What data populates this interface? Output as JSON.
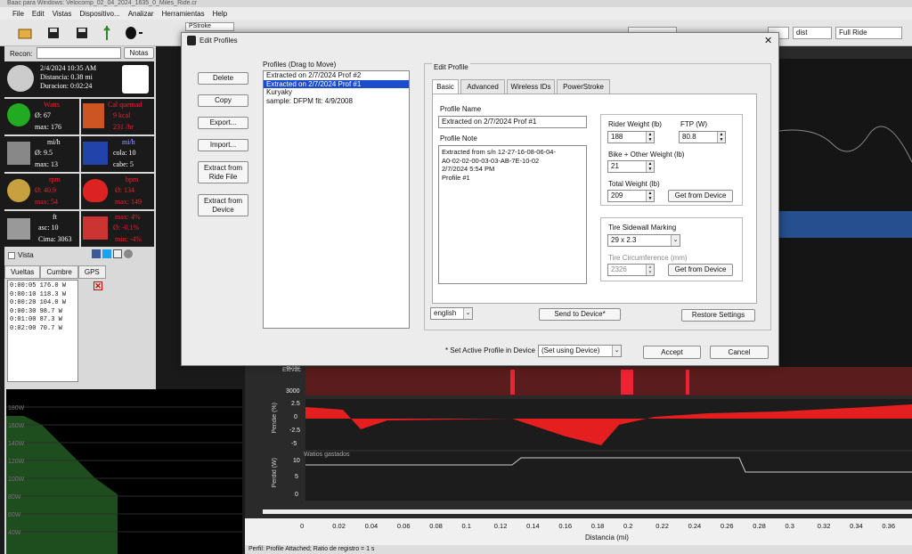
{
  "app": {
    "title": "Baac para Windows: Velocomp_02_04_2024_1635_0_Miles_Ride.cr"
  },
  "menu": [
    "File",
    "Edit",
    "Vistas",
    "Dispositivo...",
    "Analizar",
    "Herramientas",
    "Help"
  ],
  "toolbar": {
    "pstroke": "PStroke",
    "dist": "dist",
    "fullride": "Full Ride"
  },
  "left": {
    "recon": "Recon:",
    "notas": "Notas",
    "date": "2/4/2024 10:35 AM",
    "distancia": "Distancia: 0.38 mi",
    "duracion": "Duracion: 0:02:24",
    "watts": {
      "title": "Watts",
      "avg": "Ø: 67",
      "max": "max: 176"
    },
    "cal": {
      "title": "Cal quemad",
      "val": "9 kcal",
      "rate": "231 /hr"
    },
    "speed": {
      "title": "mi/h",
      "avg": "Ø: 9.5",
      "max": "max: 13"
    },
    "wind": {
      "title": "mi/h",
      "cola": "cola: 10",
      "cabe": "cabe: 5"
    },
    "rpm": {
      "title": "rpm",
      "avg": "Ø: 40.9",
      "max": "max: 54"
    },
    "bpm": {
      "title": "bpm",
      "avg": "Ø: 134",
      "max": "max: 149"
    },
    "elev": {
      "title": "ft",
      "asc": "asc: 10",
      "cima": "Cima: 3063"
    },
    "slope": {
      "max": "max: 4%",
      "avg": "Ø: -0.1%",
      "min": "min: -4%"
    },
    "vista": "Vista",
    "tabs": [
      "Vueltas",
      "Cumbre",
      "GPS"
    ],
    "laps": [
      "0:00:05 176.0 W",
      "0:00:10 118.3 W",
      "0:00:20 104.0 W",
      "0:00:30 98.7 W",
      "0:01:00 87.3 W",
      "0:02:00 70.7 W"
    ],
    "chart_y": [
      "180W",
      "160W",
      "140W",
      "120W",
      "100W",
      "80W",
      "60W",
      "40W",
      "20W",
      "0W"
    ]
  },
  "dialog": {
    "title": "Edit Profiles",
    "buttons": {
      "delete": "Delete",
      "copy": "Copy",
      "export": "Export...",
      "import": "Import...",
      "extract_ride": "Extract from Ride File",
      "extract_device": "Extract from Device"
    },
    "profiles_label": "Profiles (Drag to Move)",
    "profiles": [
      "Extracted on 2/7/2024 Prof #2",
      "Extracted on 2/7/2024 Prof #1",
      "Kuryaky",
      "sample: DFPM fit: 4/9/2008"
    ],
    "edit_profile": "Edit Profile",
    "tabs": [
      "Basic",
      "Advanced",
      "Wireless IDs",
      "PowerStroke"
    ],
    "profile_name_label": "Profile Name",
    "profile_name": "Extracted on 2/7/2024 Prof #1",
    "profile_note_label": "Profile Note",
    "profile_note": [
      "Extracted from s/n 12-27-16-08-06-04-",
      "A0-02-02-00-03-03-AB-7E-10-02",
      "2/7/2024 5:54 PM",
      "Profile #1"
    ],
    "rider_weight_label": "Rider Weight (lb)",
    "rider_weight": "188",
    "ftp_label": "FTP (W)",
    "ftp": "80.8",
    "bike_weight_label": "Bike + Other Weight (lb)",
    "bike_weight": "21",
    "total_weight_label": "Total Weight (lb)",
    "total_weight": "209",
    "get_from_device": "Get from Device",
    "tire_label": "Tire Sidewall Marking",
    "tire": "29 x 2.3",
    "circ_label": "Tire Circumference (mm)",
    "circ": "2326",
    "language": "english",
    "send": "Send to Device*",
    "restore": "Restore Settings",
    "active_label": "* Set Active Profile in Device",
    "active_value": "(Set using Device)",
    "accept": "Accept",
    "cancel": "Cancel"
  },
  "chart": {
    "elev_ticks": [
      "3050",
      "3000"
    ],
    "elev_label": "Elevac",
    "slope_ticks": [
      "2.5",
      "0",
      "-2.5",
      "-5"
    ],
    "slope_label": "Pendie (%)",
    "power_label": "Watios gastados",
    "power_axis": "Perdid (W)",
    "power_ticks": [
      "10",
      "5",
      "0"
    ],
    "x_ticks": [
      "0",
      "0.02",
      "0.04",
      "0.06",
      "0.08",
      "0.1",
      "0.12",
      "0.14",
      "0.16",
      "0.18",
      "0.2",
      "0.22",
      "0.24",
      "0.26",
      "0.28",
      "0.3",
      "0.32",
      "0.34",
      "0.36"
    ],
    "x_label": "Distancia (mi)"
  },
  "status": "Perfil: Profile Attached; Ratio de registro = 1 s"
}
